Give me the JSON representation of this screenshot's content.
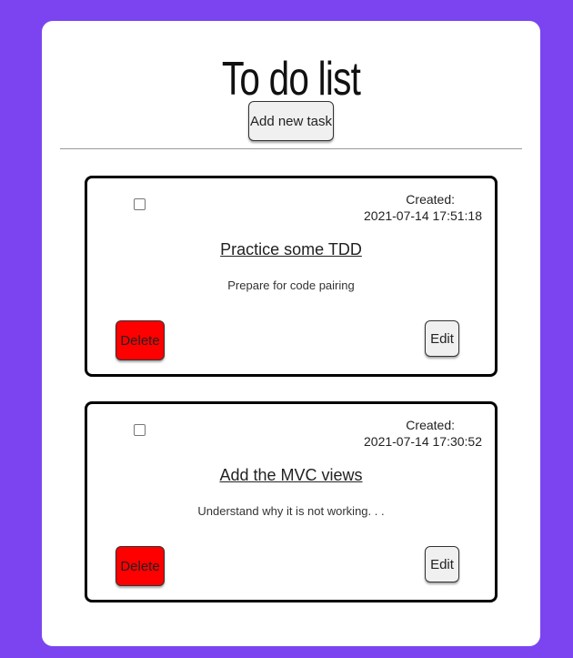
{
  "page": {
    "title": "To do list",
    "add_button_label": "Add new task"
  },
  "colors": {
    "background": "#7b44f0",
    "card_background": "#ffffff",
    "delete_button": "#ff0000",
    "default_button": "#f0f0f0"
  },
  "tasks": [
    {
      "checked": false,
      "created_label": "Created:",
      "created_at": "2021-07-14 17:51:18",
      "title": "Practice some TDD",
      "description": "Prepare for code pairing",
      "delete_label": "Delete",
      "edit_label": "Edit"
    },
    {
      "checked": false,
      "created_label": "Created:",
      "created_at": "2021-07-14 17:30:52",
      "title": "Add the MVC views",
      "description": "Understand why it is not working. . .",
      "delete_label": "Delete",
      "edit_label": "Edit"
    }
  ]
}
